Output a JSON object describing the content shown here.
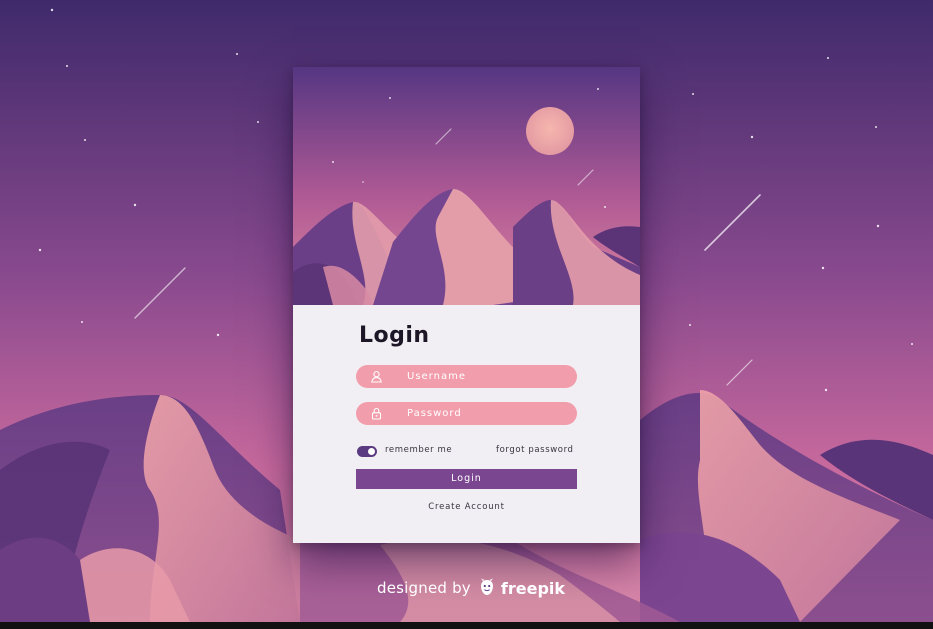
{
  "form": {
    "title": "Login",
    "username_placeholder": "Username",
    "password_placeholder": "Password",
    "remember_label": "remember me",
    "remember_checked": true,
    "forgot_label": "forgot password",
    "login_button": "Login",
    "create_account": "Create Account"
  },
  "credit": {
    "prefix": "designed by",
    "brand": "freepik"
  },
  "colors": {
    "sky_top": "#3f2a6b",
    "sky_bottom": "#d87aa0",
    "field_pink": "#f29dab",
    "button_purple": "#7b4690",
    "form_bg": "#f1eff3"
  },
  "icons": {
    "username": "user-icon",
    "password": "lock-icon",
    "brand": "freepik-logo-icon"
  }
}
